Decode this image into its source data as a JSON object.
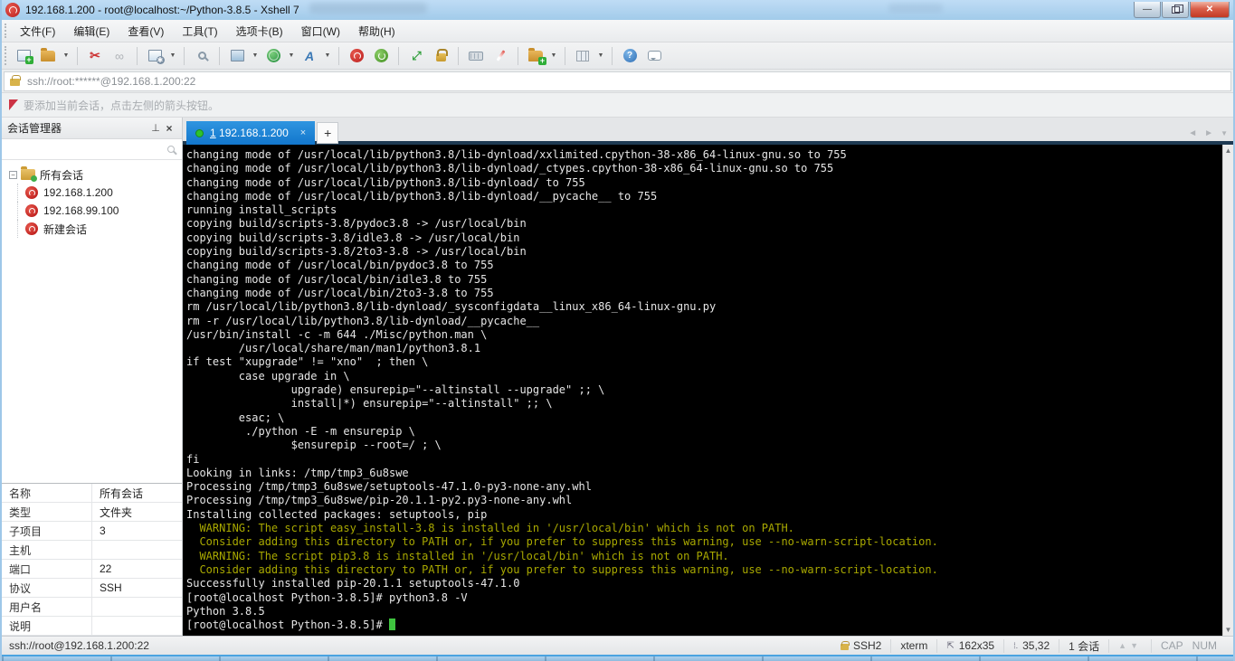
{
  "window": {
    "title": "192.168.1.200 - root@localhost:~/Python-3.8.5 - Xshell 7",
    "controls": {
      "minimize": "–",
      "restore": "restore",
      "close": "x"
    }
  },
  "menu": {
    "items": [
      "文件(F)",
      "编辑(E)",
      "查看(V)",
      "工具(T)",
      "选项卡(B)",
      "窗口(W)",
      "帮助(H)"
    ]
  },
  "toolbar": {
    "icons": [
      "new-session-icon",
      "open-folder-icon",
      "disconnect-icon",
      "reconnect-icon",
      "session-properties-icon",
      "find-icon",
      "layout-icon",
      "web-icon",
      "font-icon",
      "xshell-icon",
      "xftp-icon",
      "fullscreen-icon",
      "lock-icon",
      "virtual-keyboard-icon",
      "highlight-pen-icon",
      "new-file-icon",
      "tile-icon",
      "help-icon",
      "feedback-icon"
    ]
  },
  "address_bar": {
    "url": "ssh://root:******@192.168.1.200:22"
  },
  "hint_bar": {
    "text": "要添加当前会话，点击左侧的箭头按钮。"
  },
  "sidebar": {
    "title": "会话管理器",
    "search_value": "",
    "tree": {
      "root_label": "所有会话",
      "sessions": [
        "192.168.1.200",
        "192.168.99.100",
        "新建会话"
      ]
    },
    "properties": [
      {
        "label": "名称",
        "value": "所有会话"
      },
      {
        "label": "类型",
        "value": "文件夹"
      },
      {
        "label": "子项目",
        "value": "3"
      },
      {
        "label": "主机",
        "value": ""
      },
      {
        "label": "端口",
        "value": "22"
      },
      {
        "label": "协议",
        "value": "SSH"
      },
      {
        "label": "用户名",
        "value": ""
      },
      {
        "label": "说明",
        "value": ""
      }
    ]
  },
  "tabbar": {
    "active_tab": {
      "index": "1",
      "label": "192.168.1.200",
      "close": "×"
    },
    "new_tab_label": "+"
  },
  "terminal": {
    "lines": [
      {
        "t": "changing mode of /usr/local/lib/python3.8/lib-dynload/xxlimited.cpython-38-x86_64-linux-gnu.so to 755"
      },
      {
        "t": "changing mode of /usr/local/lib/python3.8/lib-dynload/_ctypes.cpython-38-x86_64-linux-gnu.so to 755"
      },
      {
        "t": "changing mode of /usr/local/lib/python3.8/lib-dynload/ to 755"
      },
      {
        "t": "changing mode of /usr/local/lib/python3.8/lib-dynload/__pycache__ to 755"
      },
      {
        "t": "running install_scripts"
      },
      {
        "t": "copying build/scripts-3.8/pydoc3.8 -> /usr/local/bin"
      },
      {
        "t": "copying build/scripts-3.8/idle3.8 -> /usr/local/bin"
      },
      {
        "t": "copying build/scripts-3.8/2to3-3.8 -> /usr/local/bin"
      },
      {
        "t": "changing mode of /usr/local/bin/pydoc3.8 to 755"
      },
      {
        "t": "changing mode of /usr/local/bin/idle3.8 to 755"
      },
      {
        "t": "changing mode of /usr/local/bin/2to3-3.8 to 755"
      },
      {
        "t": "rm /usr/local/lib/python3.8/lib-dynload/_sysconfigdata__linux_x86_64-linux-gnu.py"
      },
      {
        "t": "rm -r /usr/local/lib/python3.8/lib-dynload/__pycache__"
      },
      {
        "t": "/usr/bin/install -c -m 644 ./Misc/python.man \\"
      },
      {
        "t": "        /usr/local/share/man/man1/python3.8.1"
      },
      {
        "t": "if test \"xupgrade\" != \"xno\"  ; then \\"
      },
      {
        "t": "        case upgrade in \\"
      },
      {
        "t": "                upgrade) ensurepip=\"--altinstall --upgrade\" ;; \\"
      },
      {
        "t": "                install|*) ensurepip=\"--altinstall\" ;; \\"
      },
      {
        "t": "        esac; \\"
      },
      {
        "t": "         ./python -E -m ensurepip \\"
      },
      {
        "t": "                $ensurepip --root=/ ; \\"
      },
      {
        "t": "fi"
      },
      {
        "t": "Looking in links: /tmp/tmp3_6u8swe"
      },
      {
        "t": "Processing /tmp/tmp3_6u8swe/setuptools-47.1.0-py3-none-any.whl"
      },
      {
        "t": "Processing /tmp/tmp3_6u8swe/pip-20.1.1-py2.py3-none-any.whl"
      },
      {
        "t": "Installing collected packages: setuptools, pip"
      },
      {
        "t": "  WARNING: The script easy_install-3.8 is installed in '/usr/local/bin' which is not on PATH.",
        "c": "warning"
      },
      {
        "t": "  Consider adding this directory to PATH or, if you prefer to suppress this warning, use --no-warn-script-location.",
        "c": "warning"
      },
      {
        "t": "  WARNING: The script pip3.8 is installed in '/usr/local/bin' which is not on PATH.",
        "c": "warning"
      },
      {
        "t": "  Consider adding this directory to PATH or, if you prefer to suppress this warning, use --no-warn-script-location.",
        "c": "warning"
      },
      {
        "t": "Successfully installed pip-20.1.1 setuptools-47.1.0"
      },
      {
        "t": "[root@localhost Python-3.8.5]# python3.8 -V"
      },
      {
        "t": "Python 3.8.5"
      },
      {
        "t": "[root@localhost Python-3.8.5]# ",
        "cursor": true
      }
    ]
  },
  "status_bar": {
    "left_url": "ssh://root@192.168.1.200:22",
    "protocol": "SSH2",
    "term_type": "xterm",
    "size_icon": "⇲",
    "size": "162x35",
    "cursor_pos": "35,32",
    "session_count": "1 会话",
    "cap": "CAP",
    "num": "NUM"
  },
  "colors": {
    "terminal_bg": "#000000",
    "terminal_fg": "#e6e6e6",
    "warning_fg": "#a8a800",
    "cursor_green": "#3fc43f",
    "active_tab_blue": "#1581d2",
    "titlebar_blue": "#a7cdec",
    "tab_strip_dark": "#1e3a52"
  }
}
